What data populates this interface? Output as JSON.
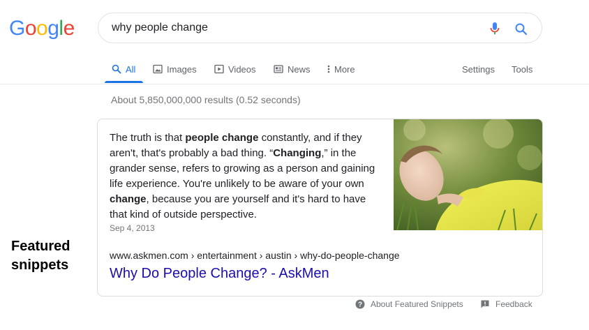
{
  "logo": {
    "letters": [
      "G",
      "o",
      "o",
      "g",
      "l",
      "e"
    ],
    "colors": [
      "#4285F4",
      "#EA4335",
      "#FBBC05",
      "#4285F4",
      "#34A853",
      "#EA4335"
    ]
  },
  "search": {
    "query": "why people change",
    "mic_icon": "mic-icon",
    "search_icon": "search-icon"
  },
  "tabs": [
    {
      "label": "All",
      "icon": "search-icon"
    },
    {
      "label": "Images",
      "icon": "image-icon"
    },
    {
      "label": "Videos",
      "icon": "play-icon"
    },
    {
      "label": "News",
      "icon": "news-icon"
    },
    {
      "label": "More",
      "icon": "more-vert-icon"
    }
  ],
  "settings_label": "Settings",
  "tools_label": "Tools",
  "result_stats": "About 5,850,000,000 results (0.52 seconds)",
  "featured": {
    "parts": [
      {
        "t": "The truth is that ",
        "b": false
      },
      {
        "t": "people change",
        "b": true
      },
      {
        "t": " constantly, and if they aren't, that's probably a bad thing. “",
        "b": false
      },
      {
        "t": "Changing",
        "b": true
      },
      {
        "t": ",” in the grander sense, refers to growing as a person and gaining life experience. You're unlikely to be aware of your own ",
        "b": false
      },
      {
        "t": "change",
        "b": true
      },
      {
        "t": ", because you are yourself and it's hard to have that kind of outside perspective.",
        "b": false
      }
    ],
    "date": "Sep 4, 2013",
    "cite": "www.askmen.com › entertainment › austin › why-do-people-change",
    "title": "Why Do People Change? - AskMen"
  },
  "side_label": {
    "line1": "Featured",
    "line2": "snippets"
  },
  "footer": {
    "about": "About Featured Snippets",
    "feedback": "Feedback"
  },
  "colors": {
    "link": "#1a0dab",
    "accent": "#1a73e8"
  }
}
